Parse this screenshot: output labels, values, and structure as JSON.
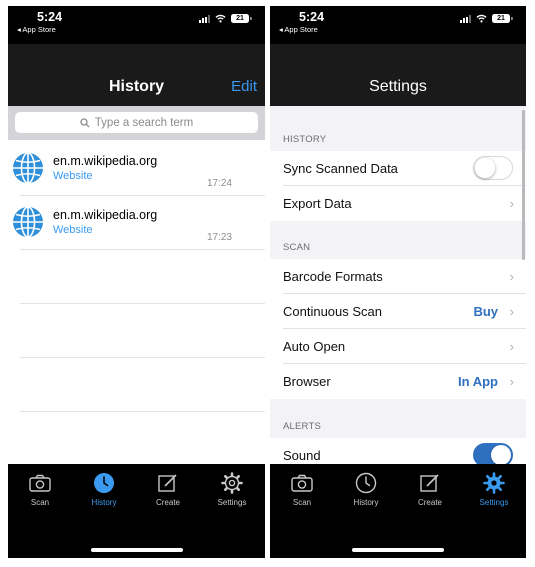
{
  "left_screen": {
    "status": {
      "time": "5:24",
      "back_app": "◂ App Store",
      "battery": "21"
    },
    "nav": {
      "title": "History",
      "edit_label": "Edit"
    },
    "search": {
      "placeholder": "Type a search term"
    },
    "history": [
      {
        "title": "en.m.wikipedia.org",
        "type": "Website",
        "time": "17:24"
      },
      {
        "title": "en.m.wikipedia.org",
        "type": "Website",
        "time": "17:23"
      }
    ],
    "tabs": [
      {
        "label": "Scan",
        "icon": "camera-icon"
      },
      {
        "label": "History",
        "icon": "clock-icon",
        "active": true
      },
      {
        "label": "Create",
        "icon": "edit-icon"
      },
      {
        "label": "Settings",
        "icon": "gear-icon"
      }
    ]
  },
  "right_screen": {
    "status": {
      "time": "5:24",
      "back_app": "◂ App Store",
      "battery": "21"
    },
    "nav": {
      "title": "Settings"
    },
    "sections": {
      "history": {
        "header": "HISTORY",
        "sync_label": "Sync Scanned Data",
        "sync_on": false,
        "export_label": "Export Data"
      },
      "scan": {
        "header": "SCAN",
        "formats_label": "Barcode Formats",
        "continuous_label": "Continuous Scan",
        "continuous_value": "Buy",
        "autoopen_label": "Auto Open",
        "browser_label": "Browser",
        "browser_value": "In App"
      },
      "alerts": {
        "header": "ALERTS",
        "sound_label": "Sound",
        "sound_on": true
      }
    },
    "tabs": [
      {
        "label": "Scan",
        "icon": "camera-icon"
      },
      {
        "label": "History",
        "icon": "clock-icon"
      },
      {
        "label": "Create",
        "icon": "edit-icon"
      },
      {
        "label": "Settings",
        "icon": "gear-icon",
        "active": true
      }
    ]
  },
  "colors": {
    "accent": "#3a9aef",
    "value_blue": "#2f6fbf",
    "toggle_on": "#2f6fbf"
  }
}
